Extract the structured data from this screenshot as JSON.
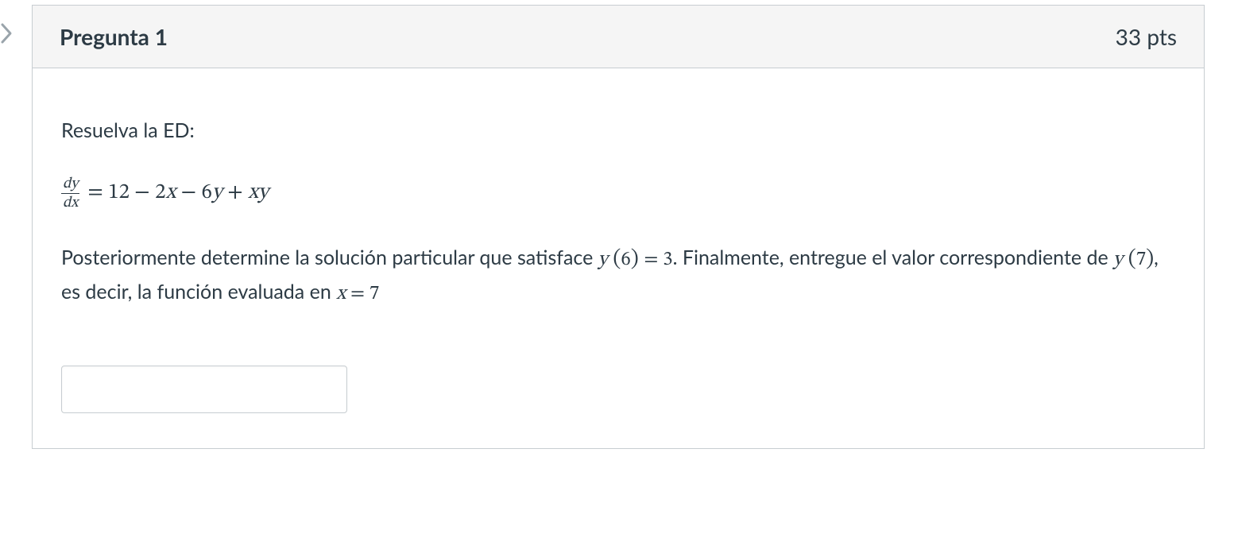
{
  "caret": {
    "icon": "chevron-right"
  },
  "question": {
    "header": {
      "title": "Pregunta 1",
      "points": "33 pts"
    },
    "body": {
      "prompt1": "Resuelva la ED:",
      "equation": {
        "frac_num": "dy",
        "frac_den": "dx",
        "rhs_1": " = 12 − 2",
        "rhs_x1": "x",
        "rhs_2": " − 6",
        "rhs_y1": "y",
        "rhs_3": " + ",
        "rhs_x2": "x",
        "rhs_y2": "y"
      },
      "prompt2": {
        "t1": "Posteriormente determine la solución particular que satisface ",
        "m1_y": "y",
        "m1_lp": " (",
        "m1_arg": "6",
        "m1_rp": ") ",
        "m1_eq": "= 3",
        "t2": ". Finalmente, entregue el valor correspondiente de ",
        "m2_y": "y",
        "m2_lp": " (",
        "m2_arg": "7",
        "m2_rp": ")",
        "t3": ", es decir, la función evaluada en ",
        "m3_x": "x",
        "m3_eq": " = 7"
      },
      "answer_value": ""
    }
  }
}
